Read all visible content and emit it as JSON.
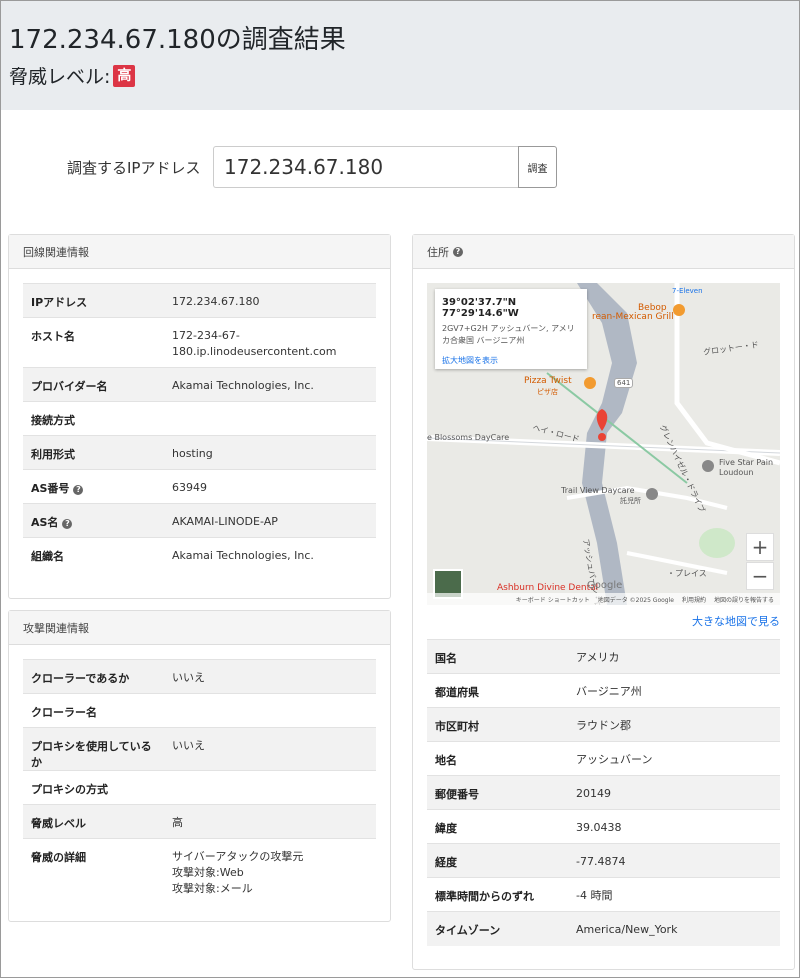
{
  "header": {
    "title": "172.234.67.180の調査結果",
    "threat_label": "脅威レベル:",
    "threat_badge": "高"
  },
  "search": {
    "label": "調査するIPアドレス",
    "value": "172.234.67.180",
    "button": "調査"
  },
  "network": {
    "title": "回線関連情報",
    "rows": [
      {
        "key": "IPアドレス",
        "value": "172.234.67.180"
      },
      {
        "key": "ホスト名",
        "value": "172-234-67-\n180.ip.linodeusercontent.com"
      },
      {
        "key": "プロバイダー名",
        "value": "Akamai Technologies, Inc."
      },
      {
        "key": "接続方式",
        "value": ""
      },
      {
        "key": "利用形式",
        "value": "hosting"
      },
      {
        "key": "AS番号",
        "value": "63949"
      },
      {
        "key": "AS名",
        "value": "AKAMAI-LINODE-AP"
      },
      {
        "key": "組織名",
        "value": "Akamai Technologies, Inc."
      }
    ]
  },
  "attack": {
    "title": "攻撃関連情報",
    "rows": [
      {
        "key": "クローラーであるか",
        "value": "いいえ"
      },
      {
        "key": "クローラー名",
        "value": ""
      },
      {
        "key": "プロキシを使用しているか",
        "value": "いいえ"
      },
      {
        "key": "プロキシの方式",
        "value": ""
      },
      {
        "key": "脅威レベル",
        "value": "高"
      },
      {
        "key": "脅威の詳細",
        "value": "サイバーアタックの攻撃元\n攻撃対象:Web\n攻撃対象:メール"
      }
    ]
  },
  "address": {
    "title": "住所",
    "map": {
      "coords": "39°02'37.7\"N 77°29'14.6\"W",
      "plus_code": "2GV7+G2H アッシュバーン, アメリカ合衆国 バージニア州",
      "enlarge_link": "拡大地図を表示",
      "labels": {
        "bebop": "Bebop",
        "mexican": "rean-Mexican Grill",
        "eleven": "7-Eleven",
        "pizza": "Pizza Twist",
        "pizza_jp": "ピザ店",
        "daycare": "e Blossoms DayCare",
        "five_star": "Five Star Pain",
        "loudoun": "Loudoun",
        "trail_view": "Trail View Daycare",
        "trail_view_jp": "託児所",
        "ashburn_dental": "Ashburn Divine Dental",
        "road_641": "641",
        "hay_road": "ヘイ・ロード",
        "grotto": "グロットー・ド",
        "glenn": "グレンハイゼル・ドライブ",
        "ashburn_rd": "アッシュバーン・ロ",
        "place": "・プレイス",
        "google": "Google"
      },
      "zoom_in": "+",
      "zoom_out": "−",
      "footer": [
        "キーボード ショートカット",
        "地図データ ©2025 Google",
        "利用規約",
        "地図の誤りを報告する"
      ]
    },
    "big_map_link": "大きな地図で見る",
    "rows": [
      {
        "key": "国名",
        "value": "アメリカ"
      },
      {
        "key": "都道府県",
        "value": "バージニア州"
      },
      {
        "key": "市区町村",
        "value": "ラウドン郡"
      },
      {
        "key": "地名",
        "value": "アッシュバーン"
      },
      {
        "key": "郵便番号",
        "value": "20149"
      },
      {
        "key": "緯度",
        "value": "39.0438"
      },
      {
        "key": "経度",
        "value": "-77.4874"
      },
      {
        "key": "標準時間からのずれ",
        "value": "-4 時間"
      },
      {
        "key": "タイムゾーン",
        "value": "America/New_York"
      }
    ]
  },
  "colors": {
    "badge": "#dc3545",
    "header_bg": "#e9ecef",
    "link": "#1a73e8",
    "map_pin": "#ea4335",
    "map_road": "#b0b8c4",
    "map_green": "#cfe8c9"
  },
  "icons": [
    "help-circle-icon",
    "map-pin-icon",
    "zoom-in-icon",
    "zoom-out-icon",
    "restaurant-icon"
  ]
}
